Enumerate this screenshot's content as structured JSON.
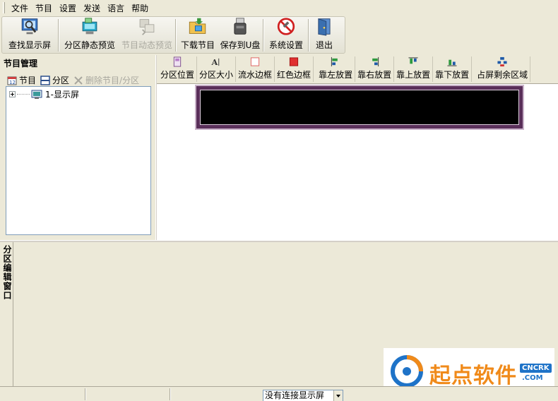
{
  "menu": [
    "文件",
    "节目",
    "设置",
    "发送",
    "语言",
    "帮助"
  ],
  "toolbar": {
    "find_screen": "查找显示屏",
    "static_preview": "分区静态预览",
    "dynamic_preview": "节目动态预览",
    "download": "下载节目",
    "save_usb": "保存到U盘",
    "system_settings": "系统设置",
    "exit": "退出"
  },
  "program_panel": {
    "title": "节目管理",
    "program": "节目",
    "partition": "分区",
    "delete": "删除节目/分区",
    "tree_item": "1-显示屏"
  },
  "partition_toolbar": {
    "position": "分区位置",
    "size": "分区大小",
    "flow_border": "流水边框",
    "red_border": "红色边框",
    "align_left": "靠左放置",
    "align_right": "靠右放置",
    "align_top": "靠上放置",
    "align_bottom": "靠下放置",
    "fill_remaining": "占屏剩余区域"
  },
  "lower_panel": {
    "tab_label": "分区编辑窗口"
  },
  "watermark": {
    "text": "起点软件",
    "badge": "CNCRK",
    "sub": ".COM"
  },
  "statusbar": {
    "connection": "没有连接显示屏"
  },
  "colors": {
    "led_frame": "#5a2f5a",
    "led_screen": "#000000",
    "red_border_icon": "#e03030",
    "watermark": "#f08a1a"
  }
}
